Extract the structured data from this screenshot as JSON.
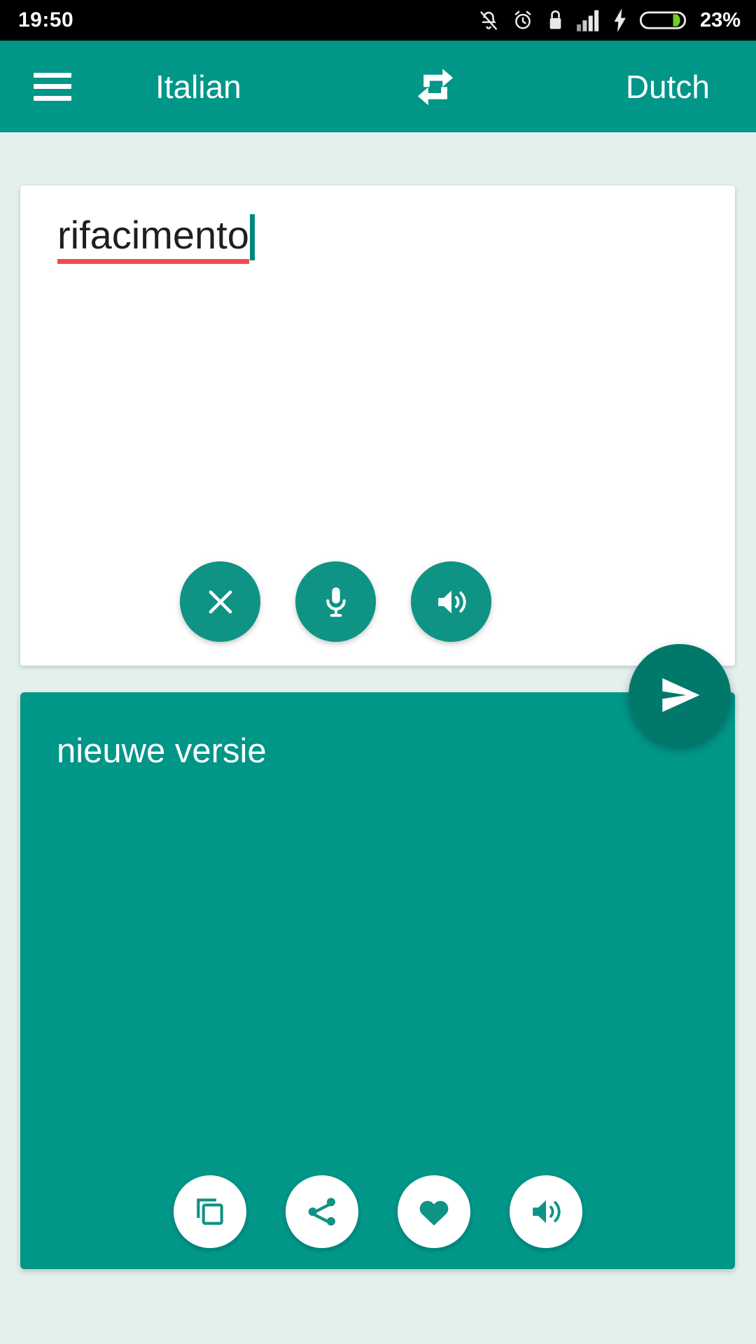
{
  "status_bar": {
    "time": "19:50",
    "battery_percent": "23%",
    "icons": [
      "notifications-off-icon",
      "alarm-icon",
      "usb-lock-icon",
      "signal-bars-icon",
      "charging-bolt-icon",
      "battery-icon"
    ],
    "colors": {
      "background": "#000000",
      "text": "#ffffff",
      "battery_fill": "#7ed321"
    }
  },
  "app_bar": {
    "menu_icon": "hamburger-menu-icon",
    "source_language": "Italian",
    "swap_icon": "swap-languages-icon",
    "target_language": "Dutch",
    "colors": {
      "background": "#009688",
      "text": "#ffffff"
    }
  },
  "input_panel": {
    "text": "rifacimento",
    "spellcheck_underline_color": "#f44a4a",
    "caret_color": "#00897b",
    "actions": [
      {
        "name": "clear-button",
        "icon": "close-icon"
      },
      {
        "name": "voice-input-button",
        "icon": "microphone-icon"
      },
      {
        "name": "speak-source-button",
        "icon": "speaker-icon"
      }
    ],
    "colors": {
      "background": "#ffffff",
      "text": "#1f1f1f",
      "button": "#0f9384"
    }
  },
  "send_button": {
    "name": "translate-send-button",
    "icon": "send-icon",
    "color": "#00796b"
  },
  "output_panel": {
    "text": "nieuwe versie",
    "actions": [
      {
        "name": "copy-button",
        "icon": "copy-icon"
      },
      {
        "name": "share-button",
        "icon": "share-icon"
      },
      {
        "name": "favorite-button",
        "icon": "heart-icon"
      },
      {
        "name": "speak-target-button",
        "icon": "speaker-icon"
      }
    ],
    "colors": {
      "background": "#009688",
      "text": "#ffffff",
      "button": "#ffffff",
      "button_icon": "#0f9384"
    }
  },
  "page": {
    "background": "#e4f0ee"
  }
}
